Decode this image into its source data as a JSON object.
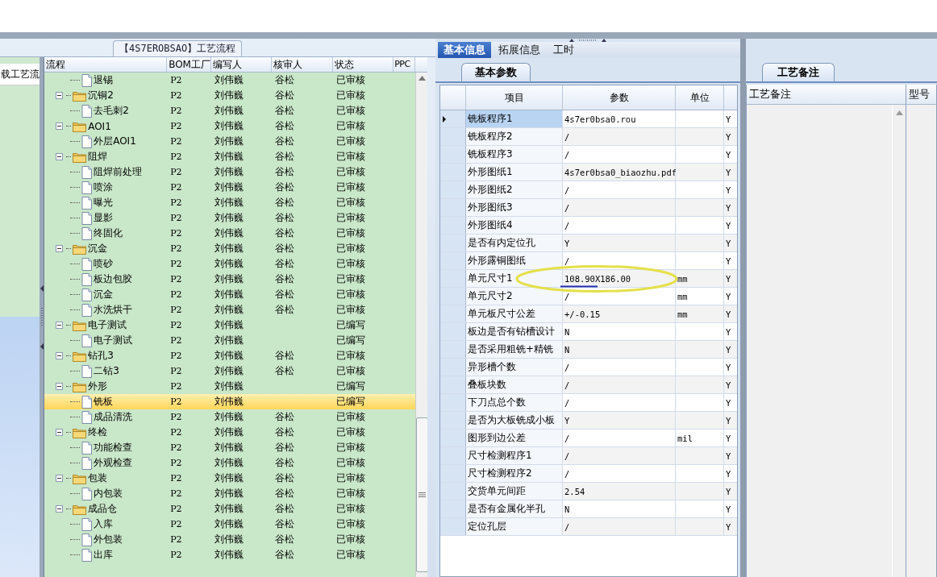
{
  "side_strip": {
    "text": "载工艺流"
  },
  "tree_panel": {
    "title": "【4S7EROBSAO】工艺流程",
    "columns": [
      "流程",
      "BOM工厂",
      "编写人",
      "核审人",
      "状态",
      "PPC"
    ],
    "continued_children": [
      {
        "kind": "file",
        "name": "退锡",
        "bom": "P2",
        "writer": "刘伟巍",
        "reviewer": "谷松",
        "status": "已审核",
        "selected": false
      }
    ],
    "nodes": [
      {
        "kind": "folder",
        "name": "沉铜2",
        "bom": "P2",
        "writer": "刘伟巍",
        "reviewer": "谷松",
        "status": "已审核",
        "selected": false,
        "expanded": true,
        "children": [
          {
            "kind": "file",
            "name": "去毛刺2",
            "bom": "P2",
            "writer": "刘伟巍",
            "reviewer": "谷松",
            "status": "已审核",
            "selected": false
          }
        ]
      },
      {
        "kind": "folder",
        "name": "AOI1",
        "bom": "P2",
        "writer": "刘伟巍",
        "reviewer": "谷松",
        "status": "已审核",
        "selected": false,
        "expanded": true,
        "children": [
          {
            "kind": "file",
            "name": "外层AOI1",
            "bom": "P2",
            "writer": "刘伟巍",
            "reviewer": "谷松",
            "status": "已审核",
            "selected": false
          }
        ]
      },
      {
        "kind": "folder",
        "name": "阻焊",
        "bom": "P2",
        "writer": "刘伟巍",
        "reviewer": "谷松",
        "status": "已审核",
        "selected": false,
        "expanded": true,
        "children": [
          {
            "kind": "file",
            "name": "阻焊前处理",
            "bom": "P2",
            "writer": "刘伟巍",
            "reviewer": "谷松",
            "status": "已审核",
            "selected": false
          },
          {
            "kind": "file",
            "name": "喷涂",
            "bom": "P2",
            "writer": "刘伟巍",
            "reviewer": "谷松",
            "status": "已审核",
            "selected": false
          },
          {
            "kind": "file",
            "name": "曝光",
            "bom": "P2",
            "writer": "刘伟巍",
            "reviewer": "谷松",
            "status": "已审核",
            "selected": false
          },
          {
            "kind": "file",
            "name": "显影",
            "bom": "P2",
            "writer": "刘伟巍",
            "reviewer": "谷松",
            "status": "已审核",
            "selected": false
          },
          {
            "kind": "file",
            "name": "终固化",
            "bom": "P2",
            "writer": "刘伟巍",
            "reviewer": "谷松",
            "status": "已审核",
            "selected": false
          }
        ]
      },
      {
        "kind": "folder",
        "name": "沉金",
        "bom": "P2",
        "writer": "刘伟巍",
        "reviewer": "谷松",
        "status": "已审核",
        "selected": false,
        "expanded": true,
        "children": [
          {
            "kind": "file",
            "name": "喷砂",
            "bom": "P2",
            "writer": "刘伟巍",
            "reviewer": "谷松",
            "status": "已审核",
            "selected": false
          },
          {
            "kind": "file",
            "name": "板边包胶",
            "bom": "P2",
            "writer": "刘伟巍",
            "reviewer": "谷松",
            "status": "已审核",
            "selected": false
          },
          {
            "kind": "file",
            "name": "沉金",
            "bom": "P2",
            "writer": "刘伟巍",
            "reviewer": "谷松",
            "status": "已审核",
            "selected": false
          },
          {
            "kind": "file",
            "name": "水洗烘干",
            "bom": "P2",
            "writer": "刘伟巍",
            "reviewer": "谷松",
            "status": "已审核",
            "selected": false
          }
        ]
      },
      {
        "kind": "folder",
        "name": "电子测试",
        "bom": "P2",
        "writer": "刘伟巍",
        "status": "已编写",
        "selected": false,
        "expanded": true,
        "children": [
          {
            "kind": "file",
            "name": "电子测试",
            "bom": "P2",
            "writer": "刘伟巍",
            "status": "已编写",
            "selected": false
          }
        ]
      },
      {
        "kind": "folder",
        "name": "钻孔3",
        "bom": "P2",
        "writer": "刘伟巍",
        "reviewer": "谷松",
        "status": "已审核",
        "selected": false,
        "expanded": true,
        "children": [
          {
            "kind": "file",
            "name": "二钻3",
            "bom": "P2",
            "writer": "刘伟巍",
            "reviewer": "谷松",
            "status": "已审核",
            "selected": false
          }
        ]
      },
      {
        "kind": "folder",
        "name": "外形",
        "bom": "P2",
        "writer": "刘伟巍",
        "status": "已编写",
        "selected": false,
        "expanded": true,
        "children": [
          {
            "kind": "file",
            "name": "铣板",
            "bom": "P2",
            "writer": "刘伟巍",
            "status": "已编写",
            "selected": true
          },
          {
            "kind": "file",
            "name": "成品清洗",
            "bom": "P2",
            "writer": "刘伟巍",
            "reviewer": "谷松",
            "status": "已审核",
            "selected": false
          }
        ]
      },
      {
        "kind": "folder",
        "name": "终检",
        "bom": "P2",
        "writer": "刘伟巍",
        "reviewer": "谷松",
        "status": "已审核",
        "selected": false,
        "expanded": true,
        "children": [
          {
            "kind": "file",
            "name": "功能检查",
            "bom": "P2",
            "writer": "刘伟巍",
            "reviewer": "谷松",
            "status": "已审核",
            "selected": false
          },
          {
            "kind": "file",
            "name": "外观检查",
            "bom": "P2",
            "writer": "刘伟巍",
            "reviewer": "谷松",
            "status": "已审核",
            "selected": false
          }
        ]
      },
      {
        "kind": "folder",
        "name": "包装",
        "bom": "P2",
        "writer": "刘伟巍",
        "reviewer": "谷松",
        "status": "已审核",
        "selected": false,
        "expanded": true,
        "children": [
          {
            "kind": "file",
            "name": "内包装",
            "bom": "P2",
            "writer": "刘伟巍",
            "reviewer": "谷松",
            "status": "已审核",
            "selected": false
          }
        ]
      },
      {
        "kind": "folder",
        "name": "成品仓",
        "bom": "P2",
        "writer": "刘伟巍",
        "reviewer": "谷松",
        "status": "已审核",
        "selected": false,
        "expanded": true,
        "children": [
          {
            "kind": "file",
            "name": "入库",
            "bom": "P2",
            "writer": "刘伟巍",
            "reviewer": "谷松",
            "status": "已审核",
            "selected": false
          },
          {
            "kind": "file",
            "name": "外包装",
            "bom": "P2",
            "writer": "刘伟巍",
            "reviewer": "谷松",
            "status": "已审核",
            "selected": false
          },
          {
            "kind": "file",
            "name": "出库",
            "bom": "P2",
            "writer": "刘伟巍",
            "reviewer": "谷松",
            "status": "已审核",
            "selected": false
          }
        ]
      }
    ]
  },
  "param_panel": {
    "tabs": [
      {
        "label": "基本信息",
        "selected": true
      },
      {
        "label": "拓展信息",
        "selected": false
      },
      {
        "label": "工时",
        "selected": false
      }
    ],
    "subtabs": [
      {
        "label": "基本参数",
        "selected": true
      }
    ],
    "columns": [
      "项目",
      "参数",
      "单位"
    ],
    "rows": [
      {
        "item": "铣板程序1",
        "value": "4s7er0bsa0.rou",
        "flag": "Y",
        "selected": true,
        "annotated": false
      },
      {
        "item": "铣板程序2",
        "value": "/",
        "flag": "Y",
        "selected": false,
        "annotated": false
      },
      {
        "item": "铣板程序3",
        "value": "/",
        "flag": "Y",
        "selected": false,
        "annotated": false
      },
      {
        "item": "外形图纸1",
        "value": "4s7er0bsa0_biaozhu.pdf",
        "flag": "Y",
        "selected": false,
        "annotated": false
      },
      {
        "item": "外形图纸2",
        "value": "/",
        "flag": "Y",
        "selected": false,
        "annotated": false
      },
      {
        "item": "外形图纸3",
        "value": "/",
        "flag": "Y",
        "selected": false,
        "annotated": false
      },
      {
        "item": "外形图纸4",
        "value": "/",
        "flag": "Y",
        "selected": false,
        "annotated": false
      },
      {
        "item": "是否有内定位孔",
        "value": "Y",
        "flag": "Y",
        "selected": false,
        "annotated": false
      },
      {
        "item": "外形露铜图纸",
        "value": "/",
        "flag": "Y",
        "selected": false,
        "annotated": false
      },
      {
        "item": "单元尺寸1",
        "value": "108.90X186.00",
        "unit": "mm",
        "flag": "Y",
        "selected": false,
        "annotated": true
      },
      {
        "item": "单元尺寸2",
        "value": "/",
        "unit": "mm",
        "flag": "Y",
        "selected": false,
        "annotated": false
      },
      {
        "item": "单元板尺寸公差",
        "value": "+/-0.15",
        "unit": "mm",
        "flag": "Y",
        "selected": false,
        "annotated": false
      },
      {
        "item": "板边是否有钻槽设计",
        "value": "N",
        "flag": "Y",
        "selected": false,
        "annotated": false
      },
      {
        "item": "是否采用粗铣+精铣",
        "value": "N",
        "flag": "Y",
        "selected": false,
        "annotated": false
      },
      {
        "item": "异形槽个数",
        "value": "/",
        "flag": "Y",
        "selected": false,
        "annotated": false
      },
      {
        "item": "叠板块数",
        "value": "/",
        "flag": "Y",
        "selected": false,
        "annotated": false
      },
      {
        "item": "下刀点总个数",
        "value": "/",
        "flag": "Y",
        "selected": false,
        "annotated": false
      },
      {
        "item": "是否为大板铣成小板",
        "value": "Y",
        "flag": "Y",
        "selected": false,
        "annotated": false
      },
      {
        "item": "图形到边公差",
        "value": "/",
        "unit": "mil",
        "flag": "Y",
        "selected": false,
        "annotated": false
      },
      {
        "item": "尺寸检测程序1",
        "value": "/",
        "flag": "Y",
        "selected": false,
        "annotated": false
      },
      {
        "item": "尺寸检测程序2",
        "value": "/",
        "flag": "Y",
        "selected": false,
        "annotated": false
      },
      {
        "item": "交货单元间距",
        "value": "2.54",
        "flag": "Y",
        "selected": false,
        "annotated": false
      },
      {
        "item": "是否有金属化半孔",
        "value": "N",
        "flag": "Y",
        "selected": false,
        "annotated": false
      },
      {
        "item": "定位孔层",
        "value": "/",
        "flag": "Y",
        "selected": false,
        "annotated": false
      }
    ]
  },
  "note_panel": {
    "tabs": [
      {
        "label": "工艺备注",
        "selected": true
      }
    ],
    "columns": [
      "工艺备注",
      "型号"
    ]
  }
}
